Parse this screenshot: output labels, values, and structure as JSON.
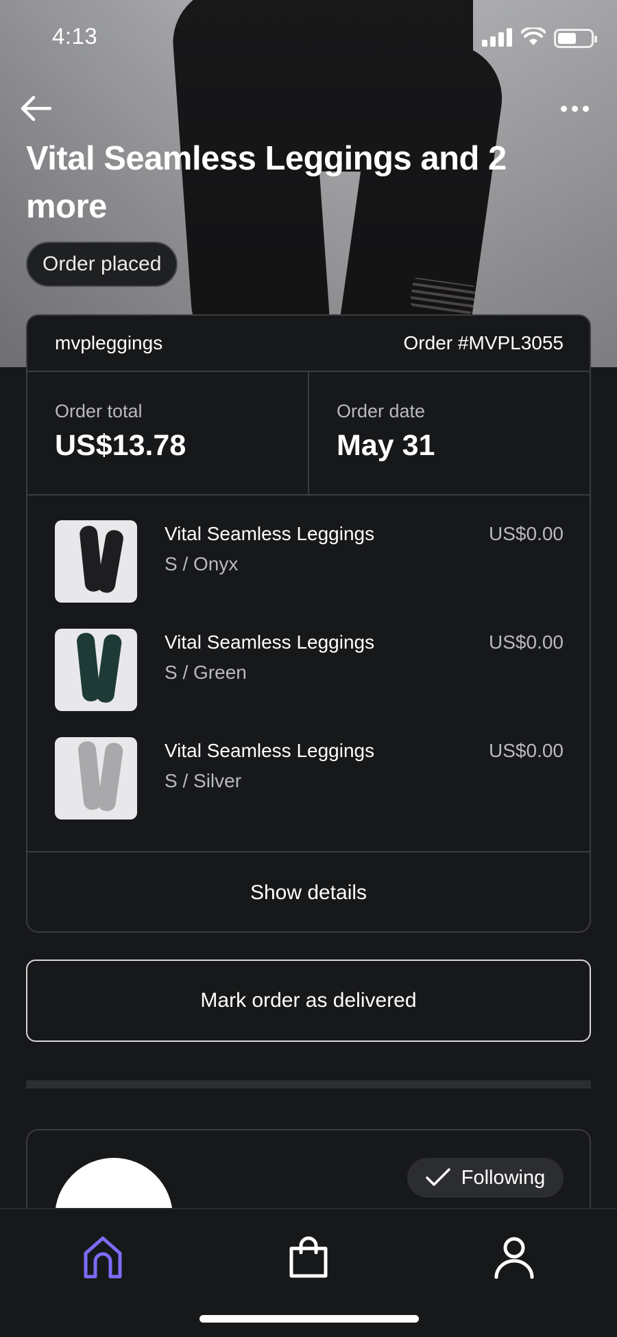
{
  "status_bar": {
    "time": "4:13"
  },
  "header": {
    "title": "Vital Seamless Leggings and 2 more",
    "order_status": "Order placed"
  },
  "order": {
    "shop_name": "mvpleggings",
    "order_number": "Order #MVPL3055",
    "total_label": "Order total",
    "total_value": "US$13.78",
    "date_label": "Order date",
    "date_value": "May 31",
    "items": [
      {
        "name": "Vital Seamless Leggings",
        "variant": "S / Onyx",
        "price": "US$0.00",
        "color": "#1e1e20"
      },
      {
        "name": "Vital Seamless Leggings",
        "variant": "S / Green",
        "price": "US$0.00",
        "color": "#1d3a36"
      },
      {
        "name": "Vital Seamless Leggings",
        "variant": "S / Silver",
        "price": "US$0.00",
        "color": "#a9a9ab"
      }
    ],
    "show_details_label": "Show details"
  },
  "actions": {
    "mark_delivered_label": "Mark order as delivered"
  },
  "shop": {
    "following_label": "Following"
  },
  "nav": {
    "active_color": "#7b6cf6",
    "tabs": [
      "home-icon",
      "shopping-bag-icon",
      "profile-icon"
    ]
  }
}
